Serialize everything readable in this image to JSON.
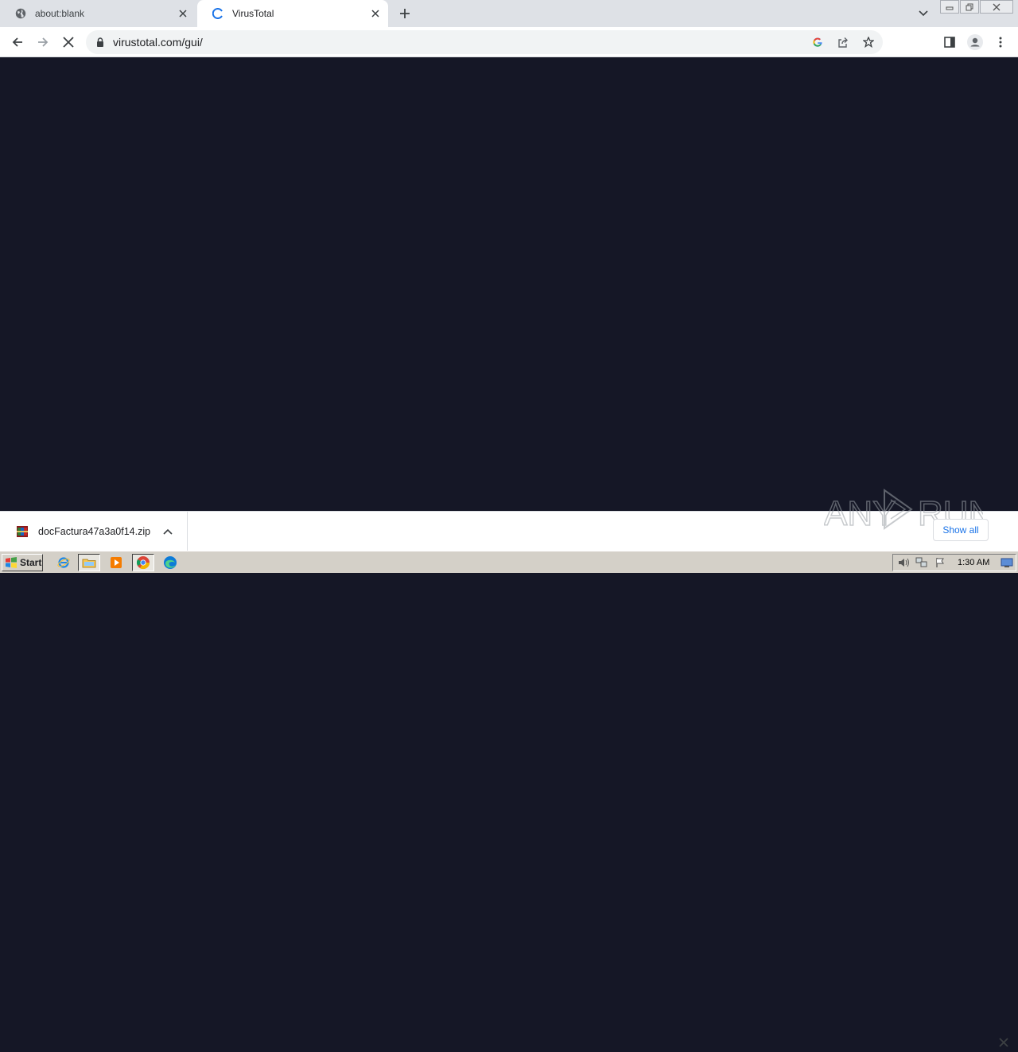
{
  "tabs": [
    {
      "title": "about:blank"
    },
    {
      "title": "VirusTotal"
    }
  ],
  "toolbar": {
    "url": "virustotal.com/gui/"
  },
  "download": {
    "filename": "docFactura47a3a0f14.zip",
    "show_all_label": "Show all"
  },
  "watermark": {
    "text": "ANY RUN"
  },
  "taskbar": {
    "start_label": "Start",
    "clock": "1:30 AM"
  },
  "colors": {
    "page_background": "#151726",
    "accent": "#1a73e8"
  }
}
